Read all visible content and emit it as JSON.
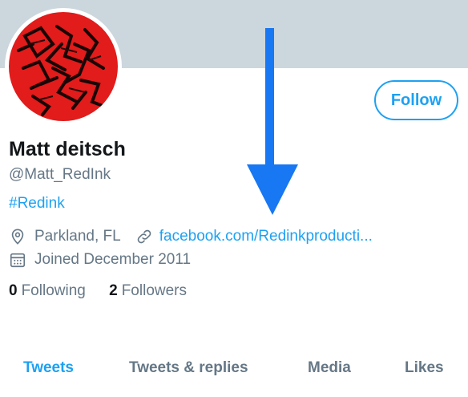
{
  "profile": {
    "display_name": "Matt deitsch",
    "handle": "@Matt_RedInk",
    "bio": "#Redink",
    "location": "Parkland, FL",
    "website": "facebook.com/Redinkproducti...",
    "joined": "Joined December 2011"
  },
  "actions": {
    "follow_label": "Follow"
  },
  "stats": {
    "following_count": "0",
    "following_label": "Following",
    "followers_count": "2",
    "followers_label": "Followers"
  },
  "tabs": [
    {
      "label": "Tweets",
      "active": true
    },
    {
      "label": "Tweets & replies",
      "active": false
    },
    {
      "label": "Media",
      "active": false
    },
    {
      "label": "Likes",
      "active": false
    }
  ],
  "colors": {
    "accent": "#1da1f2",
    "banner": "#ccd6dd",
    "muted_text": "#657786",
    "primary_text": "#14171a",
    "annotation_arrow": "#1877f2",
    "avatar_red": "#e21b1b"
  },
  "icons": {
    "location": "location-pin-icon",
    "website": "link-icon",
    "joined": "calendar-icon",
    "annotation": "down-arrow-icon"
  }
}
